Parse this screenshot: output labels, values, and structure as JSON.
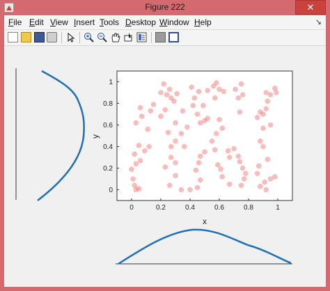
{
  "window": {
    "title": "Figure 222",
    "close_glyph": "✕"
  },
  "menu": {
    "items": [
      "File",
      "Edit",
      "View",
      "Insert",
      "Tools",
      "Desktop",
      "Window",
      "Help"
    ],
    "dock_glyph": "↘"
  },
  "toolbar": {
    "buttons": [
      "new-figure-icon",
      "open-file-icon",
      "save-icon",
      "print-icon",
      "pointer-icon",
      "zoom-in-icon",
      "zoom-out-icon",
      "pan-icon",
      "data-cursor-icon",
      "insert-colorbar-icon",
      "hide-plot-tools-icon",
      "show-plot-tools-icon"
    ]
  },
  "colors": {
    "points": "#f06b6b",
    "curve": "#1f6fb5",
    "accent": "#d46a70"
  },
  "chart_data": {
    "type": "scatter",
    "xlabel": "x",
    "ylabel": "y",
    "xlim": [
      -0.1,
      1.1
    ],
    "ylim": [
      -0.1,
      1.1
    ],
    "xticks": [
      "0",
      "0.2",
      "0.4",
      "0.6",
      "0.8",
      "1"
    ],
    "yticks": [
      "0",
      "0.2",
      "0.4",
      "0.6",
      "0.8",
      "1"
    ],
    "points": [
      [
        0.03,
        0.0
      ],
      [
        0.05,
        0.01
      ],
      [
        0.02,
        0.04
      ],
      [
        0.01,
        0.1
      ],
      [
        0.0,
        0.19
      ],
      [
        0.03,
        0.24
      ],
      [
        0.06,
        0.27
      ],
      [
        0.02,
        0.33
      ],
      [
        0.09,
        0.36
      ],
      [
        0.12,
        0.4
      ],
      [
        0.05,
        0.41
      ],
      [
        0.11,
        0.56
      ],
      [
        0.03,
        0.62
      ],
      [
        0.07,
        0.68
      ],
      [
        0.13,
        0.73
      ],
      [
        0.06,
        0.76
      ],
      [
        0.15,
        0.79
      ],
      [
        0.2,
        0.68
      ],
      [
        0.23,
        0.74
      ],
      [
        0.24,
        0.88
      ],
      [
        0.2,
        0.9
      ],
      [
        0.26,
        0.93
      ],
      [
        0.22,
        0.98
      ],
      [
        0.27,
        0.85
      ],
      [
        0.31,
        0.89
      ],
      [
        0.29,
        0.82
      ],
      [
        0.35,
        0.73
      ],
      [
        0.3,
        0.62
      ],
      [
        0.34,
        0.52
      ],
      [
        0.3,
        0.45
      ],
      [
        0.36,
        0.4
      ],
      [
        0.38,
        0.58
      ],
      [
        0.25,
        0.53
      ],
      [
        0.27,
        0.4
      ],
      [
        0.27,
        0.3
      ],
      [
        0.3,
        0.25
      ],
      [
        0.23,
        0.21
      ],
      [
        0.3,
        0.13
      ],
      [
        0.26,
        0.04
      ],
      [
        0.34,
        0.0
      ],
      [
        0.4,
        0.0
      ],
      [
        0.41,
        0.95
      ],
      [
        0.43,
        0.85
      ],
      [
        0.42,
        0.78
      ],
      [
        0.45,
        0.7
      ],
      [
        0.47,
        0.62
      ],
      [
        0.5,
        0.64
      ],
      [
        0.52,
        0.66
      ],
      [
        0.49,
        0.78
      ],
      [
        0.46,
        0.91
      ],
      [
        0.52,
        0.92
      ],
      [
        0.56,
        0.96
      ],
      [
        0.58,
        0.99
      ],
      [
        0.57,
        0.85
      ],
      [
        0.6,
        0.93
      ],
      [
        0.63,
        0.91
      ],
      [
        0.6,
        0.65
      ],
      [
        0.62,
        0.57
      ],
      [
        0.58,
        0.52
      ],
      [
        0.55,
        0.45
      ],
      [
        0.57,
        0.37
      ],
      [
        0.5,
        0.35
      ],
      [
        0.47,
        0.31
      ],
      [
        0.46,
        0.25
      ],
      [
        0.44,
        0.18
      ],
      [
        0.47,
        0.09
      ],
      [
        0.45,
        0.02
      ],
      [
        0.59,
        0.23
      ],
      [
        0.61,
        0.19
      ],
      [
        0.66,
        0.36
      ],
      [
        0.67,
        0.3
      ],
      [
        0.62,
        0.12
      ],
      [
        0.67,
        0.05
      ],
      [
        0.7,
        0.38
      ],
      [
        0.73,
        0.31
      ],
      [
        0.74,
        0.26
      ],
      [
        0.76,
        0.2
      ],
      [
        0.78,
        0.15
      ],
      [
        0.77,
        0.1
      ],
      [
        0.75,
        0.04
      ],
      [
        0.74,
        0.72
      ],
      [
        0.73,
        0.85
      ],
      [
        0.71,
        0.93
      ],
      [
        0.75,
        0.98
      ],
      [
        0.76,
        0.88
      ],
      [
        0.86,
        0.67
      ],
      [
        0.88,
        0.72
      ],
      [
        0.9,
        0.7
      ],
      [
        0.92,
        0.75
      ],
      [
        0.93,
        0.82
      ],
      [
        0.95,
        0.88
      ],
      [
        0.98,
        0.94
      ],
      [
        0.99,
        0.9
      ],
      [
        0.92,
        0.9
      ],
      [
        0.9,
        0.57
      ],
      [
        0.88,
        0.45
      ],
      [
        0.9,
        0.4
      ],
      [
        0.93,
        0.28
      ],
      [
        0.87,
        0.22
      ],
      [
        0.86,
        0.15
      ],
      [
        0.91,
        0.07
      ],
      [
        0.88,
        0.03
      ],
      [
        0.92,
        0.0
      ],
      [
        0.95,
        0.1
      ],
      [
        0.98,
        0.12
      ],
      [
        0.95,
        0.6
      ]
    ]
  }
}
